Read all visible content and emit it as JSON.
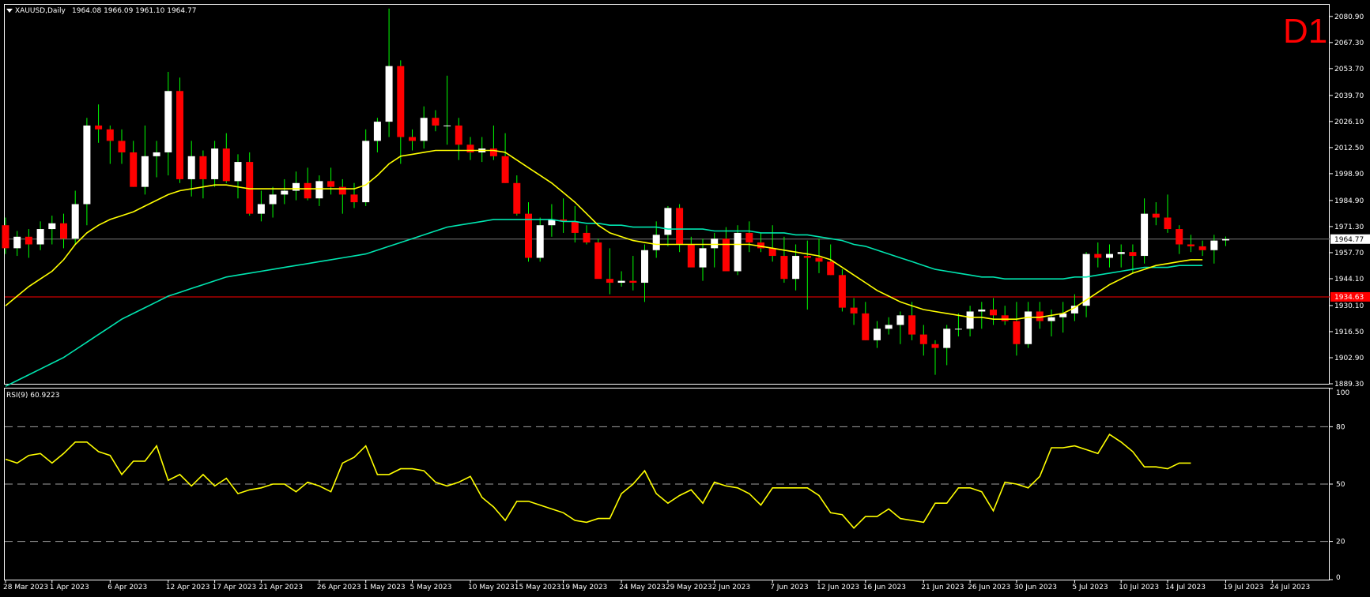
{
  "header": {
    "symbol_label": "XAUUSD,Daily",
    "ohlc": "1964.08 1966.09 1961.10 1964.77",
    "timeframe": "D1"
  },
  "colors": {
    "background": "#000000",
    "frame": "#ffffff",
    "bull_candle": "#ffffff",
    "bear_candle": "#ff0000",
    "wick": "#00ff00",
    "ma_fast": "#ffff00",
    "ma_slow": "#00e5b0",
    "bid_line": "#7a7a7a",
    "level_line": "#ff0000",
    "rsi_line": "#ffff00",
    "rsi_levels": "#a0a0a0"
  },
  "chart_data": [
    {
      "type": "candlestick",
      "title": "XAUUSD,Daily",
      "ylim": [
        1889.3,
        2087.0
      ],
      "y_ticks": [
        "2080.90",
        "2067.30",
        "2053.70",
        "2039.70",
        "2026.10",
        "2012.50",
        "1998.90",
        "1984.90",
        "1971.30",
        "1957.70",
        "1944.10",
        "1930.10",
        "1916.50",
        "1902.90",
        "1889.30"
      ],
      "x_ticks": [
        {
          "i": 0,
          "label": "28 Mar 2023"
        },
        {
          "i": 4,
          "label": "1 Apr 2023"
        },
        {
          "i": 9,
          "label": "6 Apr 2023"
        },
        {
          "i": 14,
          "label": "12 Apr 2023"
        },
        {
          "i": 18,
          "label": "17 Apr 2023"
        },
        {
          "i": 22,
          "label": "21 Apr 2023"
        },
        {
          "i": 27,
          "label": "26 Apr 2023"
        },
        {
          "i": 31,
          "label": "1 May 2023"
        },
        {
          "i": 35,
          "label": "5 May 2023"
        },
        {
          "i": 40,
          "label": "10 May 2023"
        },
        {
          "i": 44,
          "label": "15 May 2023"
        },
        {
          "i": 48,
          "label": "19 May 2023"
        },
        {
          "i": 53,
          "label": "24 May 2023"
        },
        {
          "i": 57,
          "label": "29 May 2023"
        },
        {
          "i": 61,
          "label": "2 Jun 2023"
        },
        {
          "i": 66,
          "label": "7 Jun 2023"
        },
        {
          "i": 70,
          "label": "12 Jun 2023"
        },
        {
          "i": 74,
          "label": "16 Jun 2023"
        },
        {
          "i": 79,
          "label": "21 Jun 2023"
        },
        {
          "i": 83,
          "label": "26 Jun 2023"
        },
        {
          "i": 87,
          "label": "30 Jun 2023"
        },
        {
          "i": 92,
          "label": "5 Jul 2023"
        },
        {
          "i": 96,
          "label": "10 Jul 2023"
        },
        {
          "i": 100,
          "label": "14 Jul 2023"
        },
        {
          "i": 105,
          "label": "19 Jul 2023"
        },
        {
          "i": 109,
          "label": "24 Jul 2023"
        }
      ],
      "candles": [
        [
          1972,
          1976,
          1957,
          1960
        ],
        [
          1960,
          1969,
          1956,
          1966
        ],
        [
          1966,
          1970,
          1955,
          1962
        ],
        [
          1962,
          1974,
          1959,
          1970
        ],
        [
          1970,
          1977,
          1962,
          1973
        ],
        [
          1973,
          1978,
          1960,
          1965
        ],
        [
          1965,
          1990,
          1962,
          1983
        ],
        [
          1983,
          2028,
          1972,
          2024
        ],
        [
          2024,
          2035,
          2015,
          2022
        ],
        [
          2022,
          2024,
          2004,
          2016
        ],
        [
          2016,
          2022,
          2004,
          2010
        ],
        [
          2010,
          2016,
          1992,
          1992
        ],
        [
          1992,
          2024,
          1988,
          2008
        ],
        [
          2008,
          2016,
          1997,
          2010
        ],
        [
          2010,
          2052,
          1998,
          2042
        ],
        [
          2042,
          2049,
          1994,
          1996
        ],
        [
          1996,
          2016,
          1987,
          2008
        ],
        [
          2008,
          2011,
          1986,
          1996
        ],
        [
          1996,
          2016,
          1992,
          2012
        ],
        [
          2012,
          2020,
          1994,
          1995
        ],
        [
          1995,
          2009,
          1986,
          2005
        ],
        [
          2005,
          2010,
          1977,
          1978
        ],
        [
          1978,
          1990,
          1974,
          1983
        ],
        [
          1983,
          1992,
          1976,
          1988
        ],
        [
          1988,
          1996,
          1983,
          1990
        ],
        [
          1990,
          2000,
          1985,
          1994
        ],
        [
          1994,
          2002,
          1985,
          1986
        ],
        [
          1986,
          1998,
          1982,
          1995
        ],
        [
          1995,
          2002,
          1988,
          1992
        ],
        [
          1992,
          1996,
          1978,
          1988
        ],
        [
          1988,
          1994,
          1981,
          1984
        ],
        [
          1984,
          2022,
          1982,
          2016
        ],
        [
          2016,
          2028,
          2010,
          2026
        ],
        [
          2026,
          2085,
          2018,
          2055
        ],
        [
          2055,
          2058,
          2004,
          2018
        ],
        [
          2018,
          2022,
          2011,
          2016
        ],
        [
          2016,
          2034,
          2012,
          2028
        ],
        [
          2028,
          2032,
          2021,
          2024
        ],
        [
          2024,
          2050,
          2014,
          2024
        ],
        [
          2024,
          2028,
          2006,
          2014
        ],
        [
          2014,
          2018,
          2006,
          2010
        ],
        [
          2010,
          2018,
          2005,
          2012
        ],
        [
          2012,
          2024,
          2006,
          2008
        ],
        [
          2008,
          2020,
          1994,
          1994
        ],
        [
          1994,
          1998,
          1977,
          1978
        ],
        [
          1978,
          1984,
          1953,
          1955
        ],
        [
          1955,
          1976,
          1953,
          1972
        ],
        [
          1972,
          1983,
          1966,
          1975
        ],
        [
          1975,
          1986,
          1968,
          1974
        ],
        [
          1974,
          1982,
          1963,
          1968
        ],
        [
          1968,
          1972,
          1962,
          1963
        ],
        [
          1963,
          1965,
          1946,
          1944
        ],
        [
          1944,
          1960,
          1936,
          1942
        ],
        [
          1942,
          1948,
          1940,
          1943
        ],
        [
          1943,
          1956,
          1938,
          1942
        ],
        [
          1942,
          1962,
          1932,
          1959
        ],
        [
          1959,
          1974,
          1955,
          1967
        ],
        [
          1967,
          1982,
          1961,
          1981
        ],
        [
          1981,
          1983,
          1958,
          1962
        ],
        [
          1962,
          1966,
          1951,
          1950
        ],
        [
          1950,
          1965,
          1943,
          1960
        ],
        [
          1960,
          1968,
          1950,
          1965
        ],
        [
          1965,
          1971,
          1948,
          1948
        ],
        [
          1948,
          1972,
          1946,
          1968
        ],
        [
          1968,
          1974,
          1958,
          1963
        ],
        [
          1963,
          1968,
          1958,
          1960
        ],
        [
          1960,
          1972,
          1953,
          1956
        ],
        [
          1956,
          1966,
          1942,
          1944
        ],
        [
          1944,
          1962,
          1938,
          1956
        ],
        [
          1956,
          1964,
          1928,
          1955
        ],
        [
          1955,
          1965,
          1947,
          1953
        ],
        [
          1953,
          1962,
          1946,
          1946
        ],
        [
          1946,
          1949,
          1927,
          1929
        ],
        [
          1929,
          1934,
          1920,
          1926
        ],
        [
          1926,
          1932,
          1912,
          1912
        ],
        [
          1912,
          1922,
          1908,
          1918
        ],
        [
          1918,
          1924,
          1915,
          1920
        ],
        [
          1920,
          1927,
          1910,
          1925
        ],
        [
          1925,
          1932,
          1912,
          1915
        ],
        [
          1915,
          1920,
          1904,
          1910
        ],
        [
          1910,
          1912,
          1894,
          1908
        ],
        [
          1908,
          1920,
          1899,
          1918
        ],
        [
          1918,
          1926,
          1914,
          1918
        ],
        [
          1918,
          1930,
          1914,
          1927
        ],
        [
          1927,
          1932,
          1918,
          1928
        ],
        [
          1928,
          1934,
          1920,
          1925
        ],
        [
          1925,
          1930,
          1920,
          1922
        ],
        [
          1922,
          1932,
          1904,
          1910
        ],
        [
          1910,
          1932,
          1908,
          1927
        ],
        [
          1927,
          1932,
          1918,
          1922
        ],
        [
          1922,
          1928,
          1914,
          1924
        ],
        [
          1924,
          1932,
          1916,
          1926
        ],
        [
          1926,
          1936,
          1922,
          1930
        ],
        [
          1930,
          1958,
          1924,
          1957
        ],
        [
          1957,
          1963,
          1950,
          1955
        ],
        [
          1955,
          1962,
          1950,
          1957
        ],
        [
          1957,
          1962,
          1950,
          1958
        ],
        [
          1958,
          1962,
          1947,
          1956
        ],
        [
          1956,
          1986,
          1952,
          1978
        ],
        [
          1978,
          1984,
          1972,
          1976
        ],
        [
          1976,
          1988,
          1968,
          1970
        ],
        [
          1970,
          1972,
          1957,
          1962
        ],
        [
          1962,
          1967,
          1958,
          1961
        ],
        [
          1961,
          1964,
          1956,
          1959
        ],
        [
          1959,
          1967,
          1952,
          1964
        ],
        [
          1964.08,
          1966.09,
          1961.1,
          1964.77
        ]
      ],
      "ma_fast": {
        "start": 0,
        "values": [
          1930,
          1935,
          1940,
          1944,
          1948,
          1954,
          1962,
          1968,
          1972,
          1975,
          1977,
          1979,
          1982,
          1985,
          1988,
          1990,
          1991,
          1992,
          1993,
          1993,
          1992,
          1991,
          1991,
          1991,
          1991,
          1991,
          1991,
          1991,
          1991,
          1991,
          1991,
          1993,
          1998,
          2004,
          2008,
          2009,
          2010,
          2011,
          2011,
          2011,
          2011,
          2011,
          2011,
          2010,
          2006,
          2002,
          1998,
          1994,
          1989,
          1984,
          1978,
          1972,
          1968,
          1966,
          1964,
          1963,
          1962,
          1962,
          1962,
          1962,
          1962,
          1962,
          1962,
          1962,
          1962,
          1961,
          1960,
          1959,
          1958,
          1957,
          1956,
          1954,
          1950,
          1946,
          1942,
          1938,
          1935,
          1932,
          1930,
          1928,
          1927,
          1926,
          1925,
          1924,
          1924,
          1923,
          1923,
          1923,
          1924,
          1924,
          1925,
          1926,
          1929,
          1933,
          1937,
          1941,
          1944,
          1947,
          1949,
          1951,
          1952,
          1953,
          1954,
          1954
        ]
      },
      "ma_slow": {
        "start": 0,
        "values": [
          1888,
          1891,
          1894,
          1897,
          1900,
          1903,
          1907,
          1911,
          1915,
          1919,
          1923,
          1926,
          1929,
          1932,
          1935,
          1937,
          1939,
          1941,
          1943,
          1945,
          1946,
          1947,
          1948,
          1949,
          1950,
          1951,
          1952,
          1953,
          1954,
          1955,
          1956,
          1957,
          1959,
          1961,
          1963,
          1965,
          1967,
          1969,
          1971,
          1972,
          1973,
          1974,
          1975,
          1975,
          1975,
          1975,
          1975,
          1975,
          1974,
          1974,
          1973,
          1973,
          1972,
          1972,
          1971,
          1971,
          1971,
          1970,
          1970,
          1970,
          1970,
          1969,
          1969,
          1969,
          1969,
          1968,
          1968,
          1968,
          1967,
          1967,
          1966,
          1965,
          1964,
          1962,
          1961,
          1959,
          1957,
          1955,
          1953,
          1951,
          1949,
          1948,
          1947,
          1946,
          1945,
          1945,
          1944,
          1944,
          1944,
          1944,
          1944,
          1944,
          1945,
          1945,
          1946,
          1947,
          1948,
          1949,
          1950,
          1950,
          1950,
          1951,
          1951,
          1951
        ]
      },
      "bid_price": 1964.77,
      "bid_label": "1964.77",
      "level_price": 1934.63,
      "level_label": "1934.63"
    },
    {
      "type": "line",
      "title": "RSI(9) 60.9223",
      "ylim": [
        0,
        100
      ],
      "y_ticks": [
        "100",
        "80",
        "50",
        "20",
        "0"
      ],
      "levels": [
        80,
        50,
        20
      ],
      "values": [
        63,
        61,
        65,
        66,
        61,
        66,
        72,
        72,
        67,
        65,
        55,
        62,
        62,
        70,
        52,
        55,
        49,
        55,
        49,
        53,
        45,
        47,
        48,
        50,
        50,
        46,
        51,
        49,
        46,
        61,
        64,
        70,
        55,
        55,
        58,
        58,
        57,
        51,
        49,
        51,
        54,
        43,
        38,
        31,
        41,
        41,
        39,
        37,
        35,
        31,
        30,
        32,
        32,
        45,
        50,
        57,
        45,
        40,
        44,
        47,
        40,
        51,
        49,
        48,
        45,
        39,
        48,
        48,
        48,
        48,
        44,
        35,
        34,
        27,
        33,
        33,
        37,
        32,
        31,
        30,
        40,
        40,
        48,
        48,
        46,
        36,
        51,
        50,
        48,
        54,
        69,
        69,
        70,
        68,
        66,
        76,
        72,
        67,
        59,
        59,
        58,
        61,
        61
      ]
    }
  ]
}
